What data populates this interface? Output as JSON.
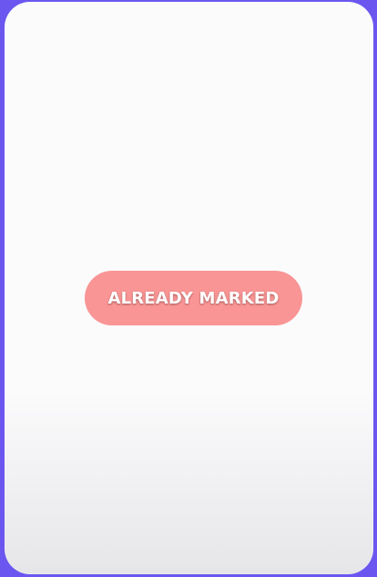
{
  "card": {
    "button_label": "ALREADY MARKED"
  },
  "colors": {
    "frame": "#6b57ef",
    "card_bg": "#fbfbfc",
    "button_bg": "#f99595",
    "button_text": "#ffffff"
  }
}
